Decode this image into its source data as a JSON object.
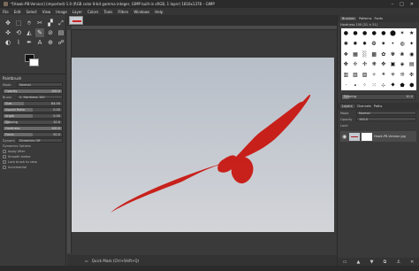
{
  "window": {
    "title": "*[Hawk-PB-Version] (imported)-1.0 (RGB color 8-bit gamma integer, GIMP built-in sRGB, 1 layer) 1816x1378 – GIMP",
    "controls": [
      "–",
      "□",
      "✕"
    ]
  },
  "menu": [
    "File",
    "Edit",
    "Select",
    "View",
    "Image",
    "Layer",
    "Colors",
    "Tools",
    "Filters",
    "Windows",
    "Help"
  ],
  "tools": [
    "✥",
    "⬚",
    "⌾",
    "✂",
    "▞",
    "⤢",
    "✜",
    "⟲",
    "◭",
    "✎",
    "⊘",
    "▤",
    "◐",
    "⌇",
    "✒",
    "A",
    "⊕",
    "☍"
  ],
  "tool_options": {
    "header": "Paintbrush",
    "mode_label": "Mode",
    "mode_value": "Normal",
    "opacity": {
      "label": "Opacity",
      "value": "100.0",
      "fraction": 1.0
    },
    "brush_label": "Brush",
    "brush_value": "2. Hardness 100",
    "size": {
      "label": "Size",
      "value": "84.00",
      "fraction": 0.35
    },
    "aspect": {
      "label": "Aspect Ratio",
      "value": "0.00",
      "fraction": 0.5
    },
    "angle": {
      "label": "Angle",
      "value": "0.00",
      "fraction": 0.5
    },
    "spacing": {
      "label": "Spacing",
      "value": "10.0",
      "fraction": 0.1
    },
    "hardness": {
      "label": "Hardness",
      "value": "100.0",
      "fraction": 1.0
    },
    "force": {
      "label": "Force",
      "value": "50.0",
      "fraction": 0.5
    },
    "dynamics_label": "Dynamics",
    "dynamics_value": "Dynamics Off",
    "dyn_options": "Dynamics Options",
    "checks": [
      {
        "label": "Apply Jitter",
        "on": false
      },
      {
        "label": "Smooth stroke",
        "on": false
      },
      {
        "label": "Lock brush to view",
        "on": false
      },
      {
        "label": "Incremental",
        "on": false
      }
    ]
  },
  "status": {
    "text": "Quick Mask (Ctrl+Shift+Q)"
  },
  "right_panel": {
    "tabs": [
      "Brushes",
      "Patterns",
      "Fonts"
    ],
    "brush_header": "Hardness 100 (51 × 51)",
    "brushes": [
      "●",
      "●",
      "●",
      "●",
      "●",
      "⬤",
      "✶",
      "★",
      "✺",
      "✹",
      "✸",
      "❂",
      "✷",
      "•",
      "◍",
      "✦",
      "❖",
      "▦",
      "░",
      "▩",
      "✿",
      "✾",
      "❀",
      "◉",
      "✤",
      "✢",
      "✣",
      "❋",
      "✥",
      "▣",
      "◈",
      "▤",
      "▥",
      "▧",
      "▨",
      "✧",
      "⚹",
      "✳",
      "❊",
      "❉",
      "·",
      "∙",
      "⁘",
      "⁙",
      "⊹",
      "⬥",
      "⬟",
      "⬢"
    ],
    "spacing": {
      "label": "Spacing",
      "value": "10.0",
      "fraction": 0.1
    },
    "layer_tabs": [
      "Layers",
      "Channels",
      "Paths"
    ],
    "mode_label": "Mode",
    "mode_value": "Normal",
    "opacity_label": "Opacity",
    "opacity_value": "100.0",
    "lock_label": "Lock:",
    "layer_name": "Hawk-PB-Version.jpg",
    "footer_icons": [
      "▭",
      "▲",
      "▼",
      "⧉",
      "⚓",
      "✕"
    ]
  }
}
